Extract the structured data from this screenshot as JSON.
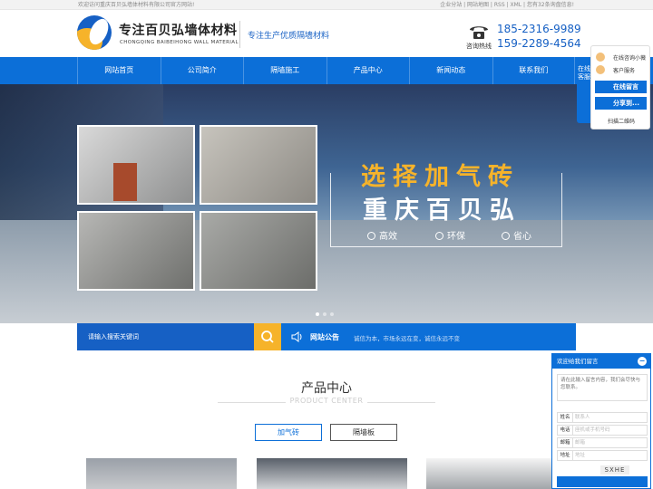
{
  "topbar": {
    "welcome": "欢迎访问重庆百贝弘墙体材料有限公司官方网站!",
    "links": "企业分站 | 网站地图 | RSS | XML | 您有32条询盘信息!"
  },
  "header": {
    "logo_cn": "专注百贝弘墙体材料",
    "logo_en": "CHONGQING BAIBEIHONG WALL MATERIAL",
    "slogan": "专注生产优质隔墙材料",
    "hotline_label": "咨询热线",
    "phone1": "185-2316-9989",
    "phone2": "159-2289-4564"
  },
  "nav": {
    "items": [
      {
        "label": "网站首页"
      },
      {
        "label": "公司简介"
      },
      {
        "label": "隔墙施工"
      },
      {
        "label": "产品中心"
      },
      {
        "label": "新闻动态"
      },
      {
        "label": "联系我们"
      }
    ]
  },
  "banner": {
    "title1": "选择加气砖",
    "title2": "重庆百贝弘",
    "features": [
      "高效",
      "环保",
      "省心"
    ],
    "slide_count": 3,
    "active_slide": 1
  },
  "search": {
    "placeholder": "请输入搜索关键词",
    "notice_label": "网站公告",
    "notice_text": "诚信为本，市场永远在变，诚信永远不变"
  },
  "products": {
    "title": "产品中心",
    "subtitle": "PRODUCT CENTER",
    "tabs": [
      {
        "label": "加气砖"
      },
      {
        "label": "隔墙板"
      }
    ]
  },
  "side_panel": {
    "tab_label": "在线客服",
    "online_label": "在线咨询小薇",
    "service_label": "客户服务",
    "qq_btn1": "在线留言",
    "qq_btn2": "分享到...",
    "qrcode_label": "扫描二维码"
  },
  "message_box": {
    "title": "欢迎给我们留言",
    "content_placeholder": "请在此输入留言内容，我们会尽快与您联系。",
    "fields": [
      {
        "label": "姓名",
        "placeholder": "联系人"
      },
      {
        "label": "电话",
        "placeholder": "座机或手机号码"
      },
      {
        "label": "邮箱",
        "placeholder": "邮箱"
      },
      {
        "label": "地址",
        "placeholder": "地址"
      }
    ],
    "captcha": "SXHE"
  },
  "colors": {
    "brand_blue": "#0c6fd8",
    "accent_yellow": "#f6b32a"
  }
}
